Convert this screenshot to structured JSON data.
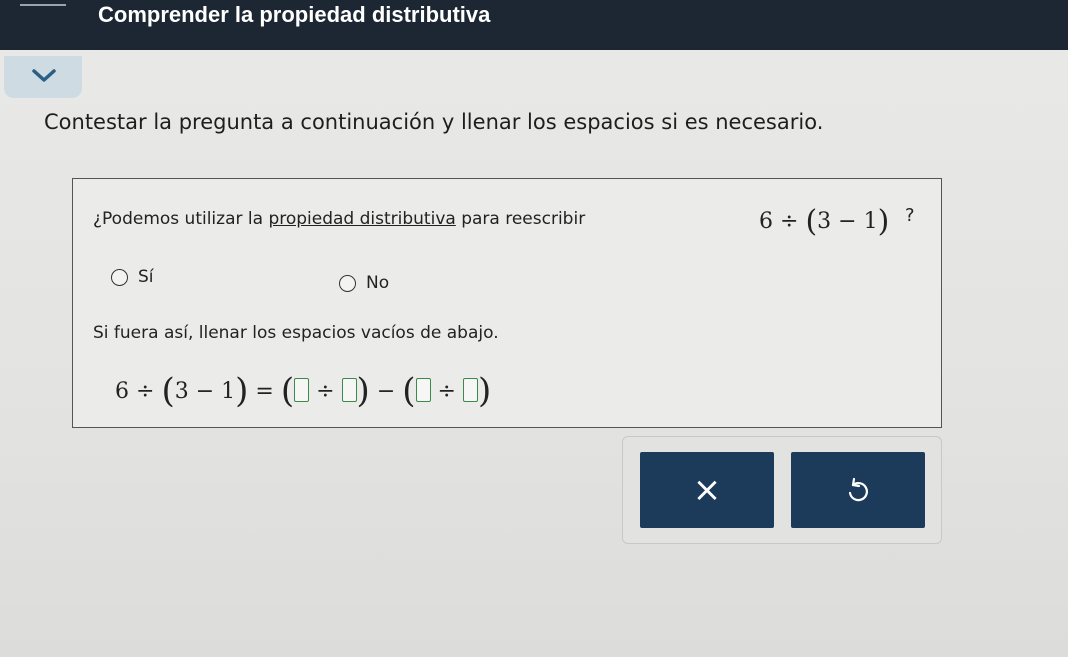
{
  "header": {
    "title": "Comprender la propiedad distributiva"
  },
  "collapse": {
    "icon": "chevron-down-icon"
  },
  "instruction": "Contestar la pregunta a continuación y llenar los espacios si es necesario.",
  "question": {
    "prefix": "¿Podemos utilizar la ",
    "link_text": "propiedad distributiva",
    "suffix": " para reescribir",
    "expr_a": "6",
    "div_sign": "÷",
    "open_paren": "(",
    "expr_b": "3",
    "minus_sign": "−",
    "expr_c": "1",
    "close_paren": ")",
    "qmark": "?"
  },
  "options": [
    {
      "label": "Sí",
      "selected": false
    },
    {
      "label": "No",
      "selected": false
    }
  ],
  "fill_prompt": "Si fuera así, llenar los espacios vacíos de abajo.",
  "equation": {
    "lhs_a": "6",
    "div": "÷",
    "open": "(",
    "lhs_b": "3",
    "minus": "−",
    "lhs_c": "1",
    "close": ")",
    "equals": "="
  },
  "buttons": {
    "clear_label": "×",
    "undo_icon": "undo-icon"
  },
  "colors": {
    "header_bg": "#1c2733",
    "button_bg": "#1c3b5a",
    "blank_border": "#3a8a4e"
  }
}
